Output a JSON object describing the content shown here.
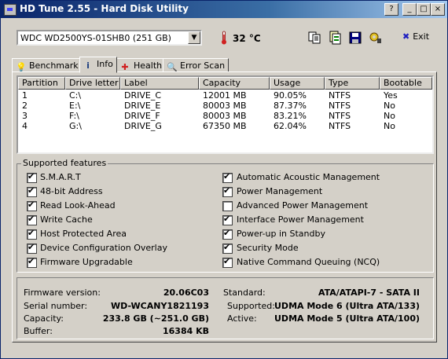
{
  "window": {
    "title": "HD Tune 2.55 - Hard Disk Utility"
  },
  "titlebar_buttons": {
    "help": "?",
    "minimize": "_",
    "maximize": "□",
    "close": "×"
  },
  "toolbar": {
    "drive": "WDC WD2500YS-01SHB0 (251 GB)",
    "temperature": "32 °C",
    "exit_label": "Exit"
  },
  "tabs": [
    {
      "label": "Benchmark",
      "icon": "benchmark-icon"
    },
    {
      "label": "Info",
      "icon": "info-icon"
    },
    {
      "label": "Health",
      "icon": "health-icon"
    },
    {
      "label": "Error Scan",
      "icon": "search-icon"
    }
  ],
  "partitions": {
    "headers": [
      "Partition",
      "Drive letter",
      "Label",
      "Capacity",
      "Usage",
      "Type",
      "Bootable"
    ],
    "rows": [
      [
        "1",
        "C:\\",
        "DRIVE_C",
        "12001 MB",
        "90.05%",
        "NTFS",
        "Yes"
      ],
      [
        "2",
        "E:\\",
        "DRIVE_E",
        "80003 MB",
        "87.37%",
        "NTFS",
        "No"
      ],
      [
        "3",
        "F:\\",
        "DRIVE_F",
        "80003 MB",
        "83.21%",
        "NTFS",
        "No"
      ],
      [
        "4",
        "G:\\",
        "DRIVE_G",
        "67350 MB",
        "62.04%",
        "NTFS",
        "No"
      ]
    ]
  },
  "features": {
    "title": "Supported features",
    "left": [
      {
        "label": "S.M.A.R.T",
        "checked": true
      },
      {
        "label": "48-bit Address",
        "checked": true
      },
      {
        "label": "Read Look-Ahead",
        "checked": true
      },
      {
        "label": "Write Cache",
        "checked": true
      },
      {
        "label": "Host Protected Area",
        "checked": true
      },
      {
        "label": "Device Configuration Overlay",
        "checked": true
      },
      {
        "label": "Firmware Upgradable",
        "checked": true
      }
    ],
    "right": [
      {
        "label": "Automatic Acoustic Management",
        "checked": true
      },
      {
        "label": "Power Management",
        "checked": true
      },
      {
        "label": "Advanced Power Management",
        "checked": false
      },
      {
        "label": "Interface Power Management",
        "checked": true
      },
      {
        "label": "Power-up in Standby",
        "checked": true
      },
      {
        "label": "Security Mode",
        "checked": true
      },
      {
        "label": "Native Command Queuing (NCQ)",
        "checked": true
      }
    ]
  },
  "info": {
    "firmware_label": "Firmware version:",
    "firmware": "20.06C03",
    "serial_label": "Serial number:",
    "serial": "WD-WCANY1821193",
    "capacity_label": "Capacity:",
    "capacity": "233.8 GB (~251.0 GB)",
    "buffer_label": "Buffer:",
    "buffer": "16384 KB",
    "standard_label": "Standard:",
    "standard": "ATA/ATAPI-7 - SATA II",
    "supported_label": "Supported:",
    "supported": "UDMA Mode 6 (Ultra ATA/133)",
    "active_label": "Active:",
    "active": "UDMA Mode 5 (Ultra ATA/100)"
  },
  "colors": {
    "titlebar_start": "#0a246a",
    "titlebar_end": "#a6caf0",
    "temp": "#d02020"
  }
}
